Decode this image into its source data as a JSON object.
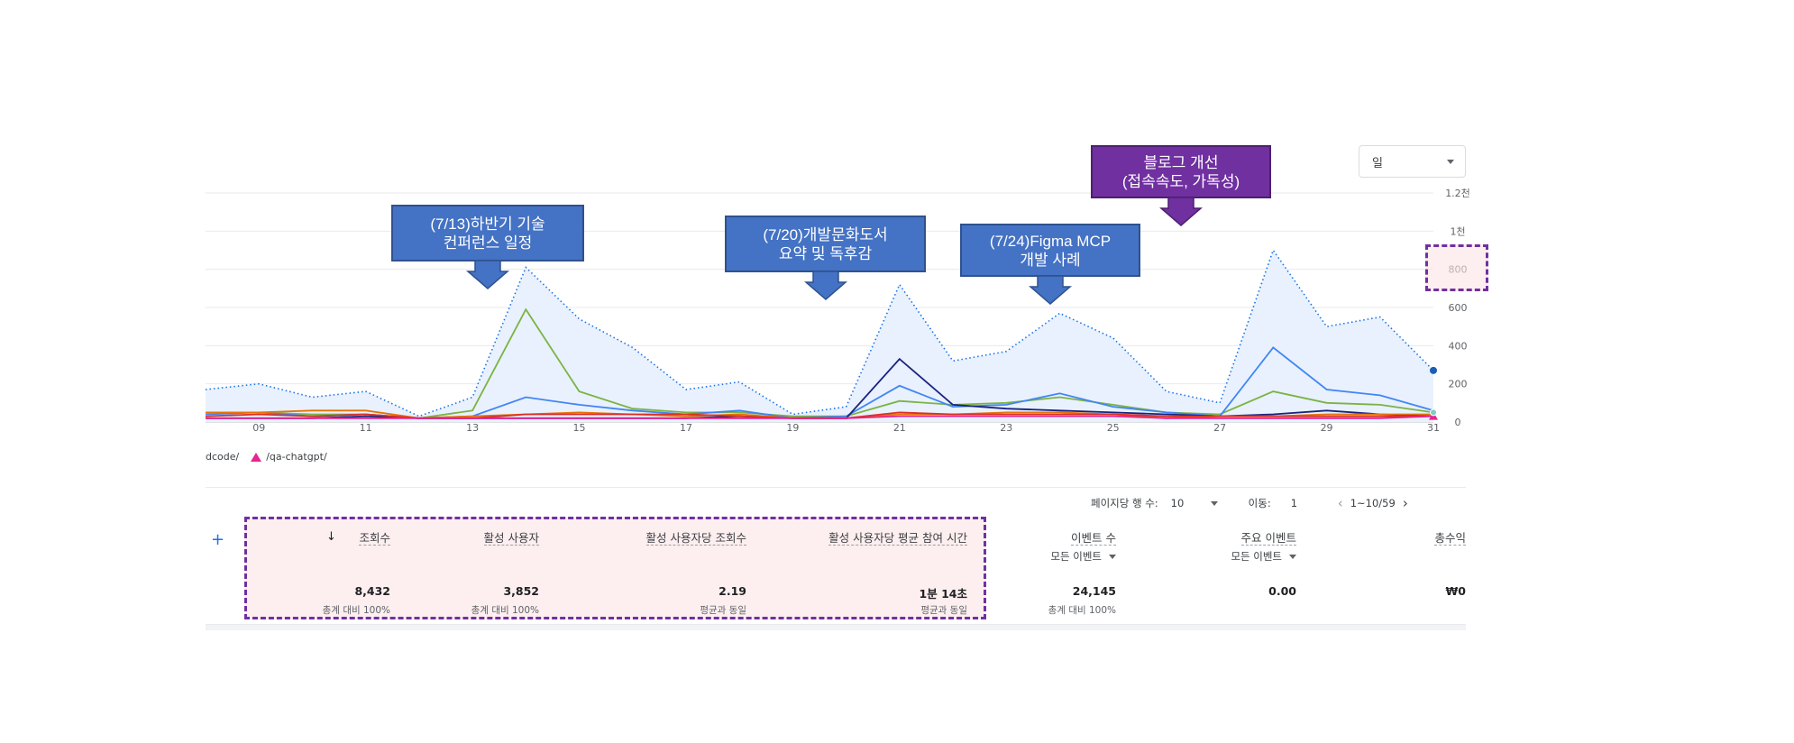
{
  "period_select": {
    "value": "일"
  },
  "y_axis": {
    "ticks": [
      "0",
      "200",
      "400",
      "600",
      "800",
      "1천",
      "1.2천"
    ]
  },
  "chart_data": {
    "type": "line",
    "x": [
      8,
      9,
      10,
      11,
      12,
      13,
      14,
      15,
      16,
      17,
      18,
      19,
      20,
      21,
      22,
      23,
      24,
      25,
      26,
      27,
      28,
      29,
      30,
      31
    ],
    "x_tick_labels": [
      "09",
      "11",
      "13",
      "15",
      "17",
      "19",
      "21",
      "23",
      "25",
      "27",
      "29",
      "31"
    ],
    "ylim": [
      0,
      1200
    ],
    "series": [
      {
        "values": [
          170,
          200,
          130,
          160,
          30,
          130,
          810,
          540,
          390,
          170,
          210,
          40,
          80,
          720,
          320,
          370,
          570,
          440,
          160,
          100,
          900,
          500,
          550,
          270
        ],
        "color": "#1a73e8",
        "style": "dotted-area"
      },
      {
        "values": [
          50,
          50,
          40,
          40,
          20,
          60,
          590,
          160,
          70,
          50,
          50,
          30,
          30,
          110,
          90,
          100,
          130,
          90,
          50,
          40,
          160,
          100,
          90,
          50
        ],
        "color": "#7cb342",
        "style": "solid"
      },
      {
        "values": [
          40,
          50,
          30,
          40,
          20,
          30,
          130,
          90,
          60,
          40,
          60,
          20,
          30,
          190,
          80,
          90,
          150,
          80,
          50,
          30,
          390,
          170,
          140,
          60
        ],
        "color": "#4285f4",
        "style": "solid"
      },
      {
        "values": [
          20,
          20,
          20,
          30,
          20,
          20,
          20,
          20,
          20,
          20,
          30,
          20,
          20,
          330,
          90,
          70,
          60,
          50,
          40,
          30,
          40,
          60,
          40,
          30
        ],
        "color": "#1a237e",
        "style": "solid"
      },
      {
        "values": [
          50,
          50,
          60,
          60,
          20,
          30,
          40,
          50,
          40,
          30,
          40,
          20,
          20,
          40,
          40,
          50,
          50,
          40,
          20,
          30,
          30,
          40,
          40,
          40
        ],
        "color": "#e8710a",
        "style": "solid"
      },
      {
        "values": [
          30,
          40,
          30,
          40,
          20,
          20,
          40,
          40,
          40,
          40,
          30,
          20,
          20,
          50,
          40,
          40,
          40,
          40,
          30,
          30,
          30,
          30,
          30,
          30
        ],
        "color": "#d93025",
        "style": "solid"
      },
      {
        "name": "/qa-chatgpt/",
        "values": [
          20,
          20,
          20,
          20,
          20,
          20,
          20,
          20,
          20,
          20,
          20,
          20,
          20,
          30,
          30,
          30,
          30,
          30,
          20,
          20,
          20,
          20,
          20,
          30
        ],
        "color": "#e52592",
        "style": "solid"
      }
    ],
    "grid": true
  },
  "legend": {
    "prev_item": "dcode/",
    "item": "/qa-chatgpt/"
  },
  "callouts": [
    {
      "line1": "(7/13)하반기 기술",
      "line2": "컨퍼런스 일정"
    },
    {
      "line1": "(7/20)개발문화도서",
      "line2": "요약 및 독후감"
    },
    {
      "line1": "(7/24)Figma MCP",
      "line2": "개발 사례"
    },
    {
      "line1": "블로그 개선",
      "line2": "(접속속도, 가독성)"
    }
  ],
  "pagination": {
    "rows_label": "페이지당 행 수:",
    "rows_value": "10",
    "goto_label": "이동:",
    "goto_value": "1",
    "range": "1~10/59",
    "prev_icon": "‹",
    "next_icon": "›"
  },
  "table": {
    "add_icon": "+",
    "sort_icon": "↓",
    "columns": [
      {
        "header": "조회수",
        "value": "8,432",
        "note": "총계 대비 100%"
      },
      {
        "header": "활성 사용자",
        "value": "3,852",
        "note": "총계 대비 100%"
      },
      {
        "header": "활성 사용자당 조회수",
        "value": "2.19",
        "note": "평균과 동일"
      },
      {
        "header": "활성 사용자당 평균 참여 시간",
        "value": "1분 14초",
        "note": "평균과 동일"
      },
      {
        "header": "이벤트 수",
        "sub": "모든 이벤트",
        "value": "24,145",
        "note": "총계 대비 100%"
      },
      {
        "header": "주요 이벤트",
        "sub": "모든 이벤트",
        "value": "0.00",
        "note": ""
      },
      {
        "header": "총수익",
        "value": "₩0",
        "note": ""
      }
    ]
  }
}
